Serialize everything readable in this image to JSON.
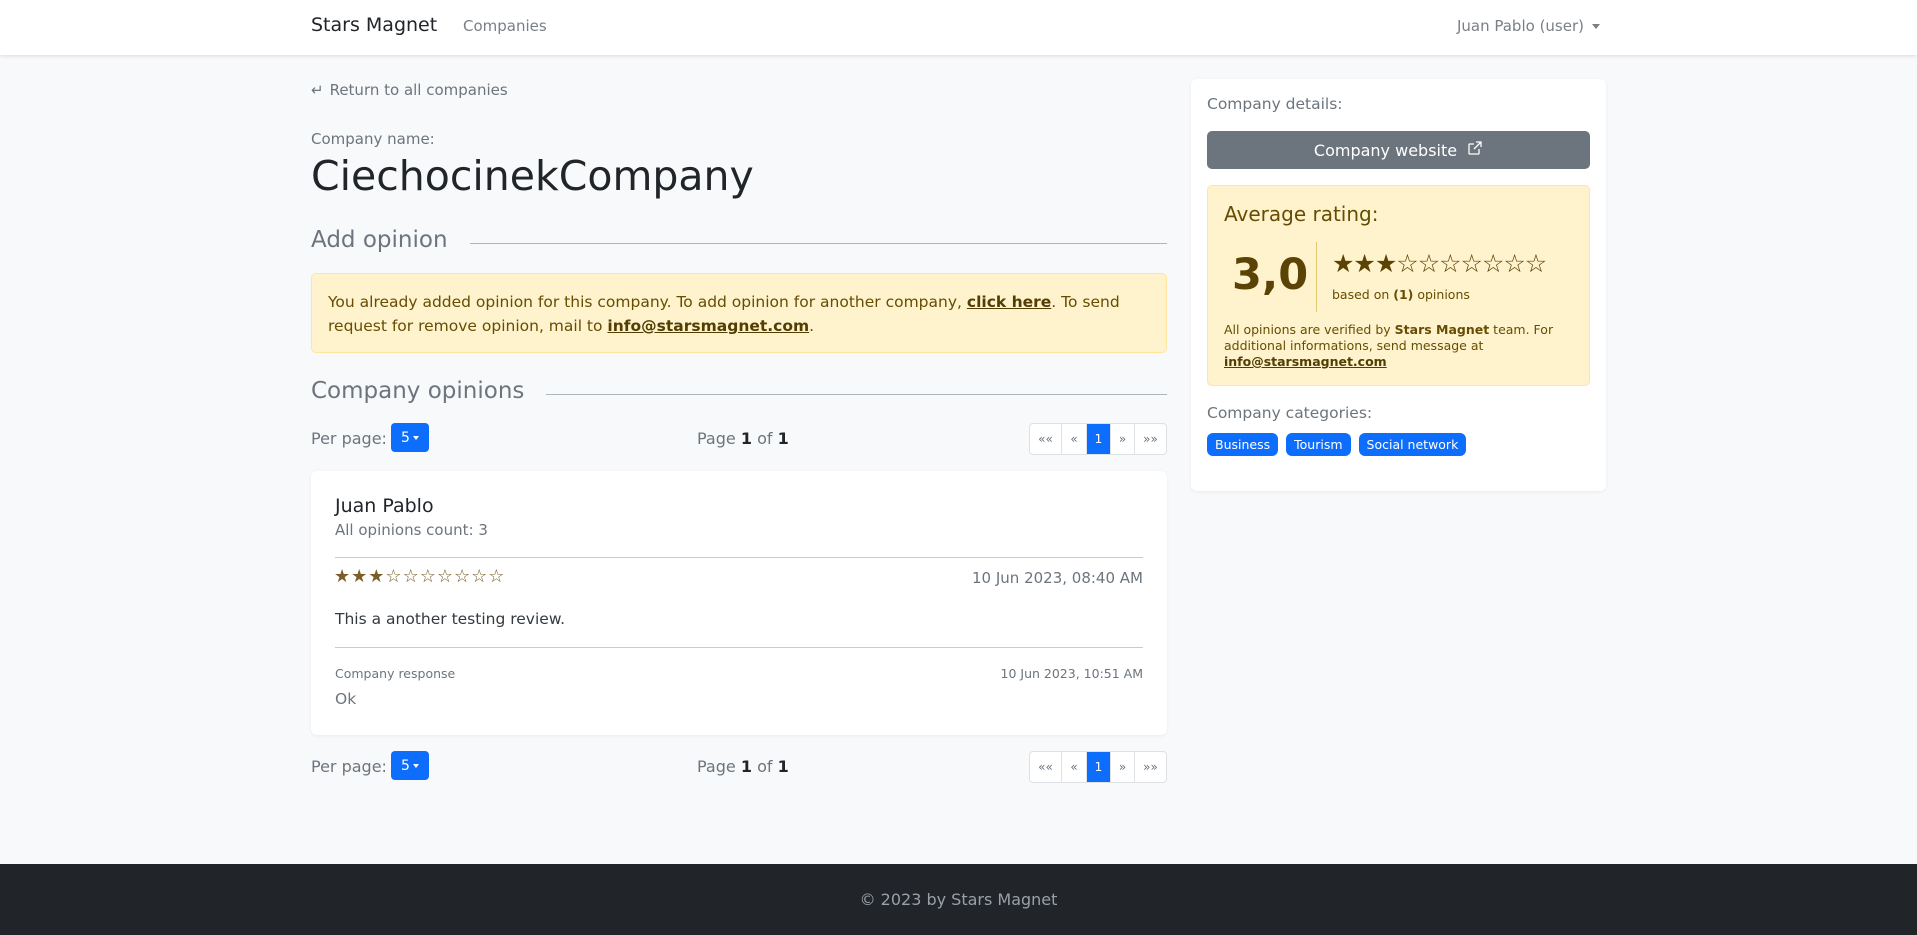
{
  "navbar": {
    "brand": "Stars Magnet",
    "companies_link": "Companies",
    "user_menu": "Juan Pablo (user)"
  },
  "main": {
    "back_link": "Return to all companies",
    "company_name_label": "Company name:",
    "company_name": "CiechocinekCompany",
    "add_opinion_heading": "Add opinion",
    "alert": {
      "text_1": "You already added opinion for this company. To add opinion for another company, ",
      "click_here": "click here",
      "text_2": ". To send request for remove opinion, mail to ",
      "email": "info@starsmagnet.com",
      "text_3": "."
    },
    "opinions_heading": "Company opinions",
    "pager": {
      "per_page_label": "Per page:",
      "per_page_value": "5",
      "page_word": "Page",
      "current_page": "1",
      "of_word": "of",
      "total_pages": "1",
      "first": "««",
      "prev": "«",
      "active": "1",
      "next": "»",
      "last": "»»"
    },
    "opinion": {
      "author": "Juan Pablo",
      "count_text": "All opinions count: 3",
      "rating": 3,
      "max_rating": 10,
      "date": "10 Jun 2023, 08:40 AM",
      "text": "This a another testing review.",
      "response_label": "Company response",
      "response_date": "10 Jun 2023, 10:51 AM",
      "response_text": "Ok"
    }
  },
  "sidebar": {
    "details_label": "Company details:",
    "website_button": "Company website",
    "average_title": "Average rating:",
    "average_value": "3,0",
    "average_stars": 3,
    "max_stars": 10,
    "based_on_1": "based on ",
    "based_on_count": "(1)",
    "based_on_2": " opinions",
    "verified_1": "All opinions are verified by ",
    "verified_brand": "Stars Magnet",
    "verified_2": " team. For additional informations, send message at ",
    "verified_email": "info@starsmagnet.com",
    "categories_label": "Company categories:",
    "categories": [
      "Business",
      "Tourism",
      "Social network"
    ]
  },
  "footer": {
    "text": "© 2023 by Stars Magnet"
  },
  "colors": {
    "primary": "#0d6efd",
    "secondary": "#6c757d",
    "warning_bg": "#fff3cd",
    "footer_bg": "#212529"
  }
}
